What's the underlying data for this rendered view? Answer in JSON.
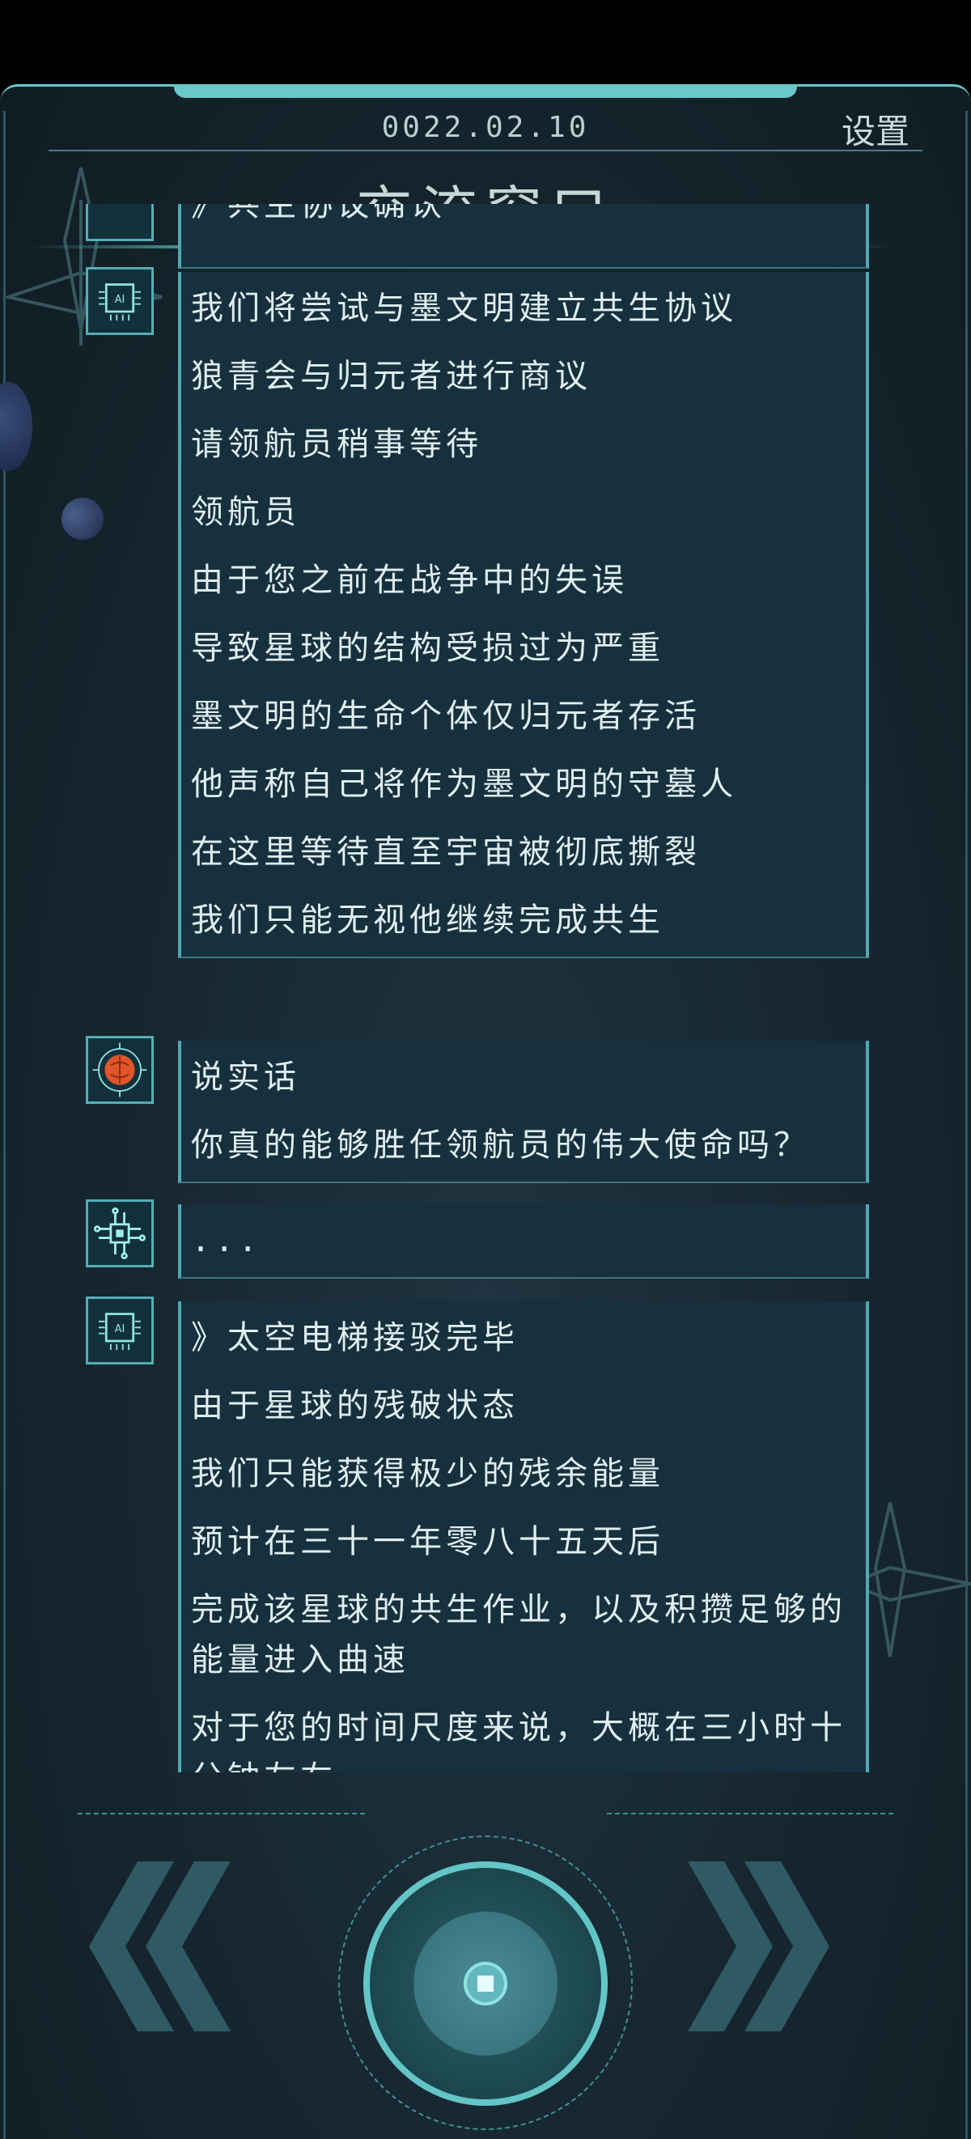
{
  "header": {
    "date": "0022.02.10",
    "settings_label": "设置",
    "title": "交流窗口"
  },
  "conversation": {
    "partial_top": "》共生协议确认",
    "group_ai_1": [
      "我们将尝试与墨文明建立共生协议",
      "狼青会与归元者进行商议",
      "请领航员稍事等待",
      "领航员",
      "由于您之前在战争中的失误",
      "导致星球的结构受损过为严重",
      "墨文明的生命个体仅归元者存活",
      "他声称自己将作为墨文明的守墓人",
      "在这里等待直至宇宙被彻底撕裂",
      "我们只能无视他继续完成共生"
    ],
    "group_brain": [
      "说实话",
      "你真的能够胜任领航员的伟大使命吗？"
    ],
    "group_chip": [
      "..."
    ],
    "group_ai_2": [
      "》太空电梯接驳完毕",
      "由于星球的残破状态",
      "我们只能获得极少的残余能量",
      "预计在三十一年零八十五天后",
      "完成该星球的共生作业，以及积攒足够的能量进入曲速",
      "对于您的时间尺度来说，大概在三小时十分钟左右"
    ]
  },
  "icons": {
    "ai_chip": "ai-chip-icon",
    "brain": "brain-icon",
    "circuit": "circuit-chip-icon",
    "prev": "double-chevron-left-icon",
    "next": "double-chevron-right-icon",
    "home": "home-button-icon"
  },
  "colors": {
    "accent": "#63c5c6",
    "bubble": "#17303d",
    "background": "#16262f",
    "brain": "#e0562a"
  }
}
